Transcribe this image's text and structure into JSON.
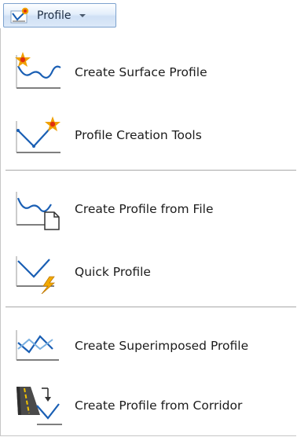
{
  "ribbon": {
    "label": "Profile",
    "icon": "profile-ribbon-icon",
    "arrow_icon": "chevron-down-icon"
  },
  "menu": {
    "items": [
      {
        "label": "Create Surface Profile",
        "icon": "create-surface-profile-icon"
      },
      {
        "label": "Profile Creation Tools",
        "icon": "profile-creation-tools-icon"
      },
      {
        "label": "Create Profile from File",
        "icon": "create-profile-from-file-icon"
      },
      {
        "label": "Quick Profile",
        "icon": "quick-profile-icon"
      },
      {
        "label": "Create Superimposed Profile",
        "icon": "create-superimposed-profile-icon"
      },
      {
        "label": "Create Profile from Corridor",
        "icon": "create-profile-from-corridor-icon"
      }
    ]
  },
  "colors": {
    "curve": "#1a5fb4",
    "baseline": "#555555",
    "starburst": "#f0a000",
    "starburst_core": "#e03010",
    "bolt": "#f2a900"
  }
}
